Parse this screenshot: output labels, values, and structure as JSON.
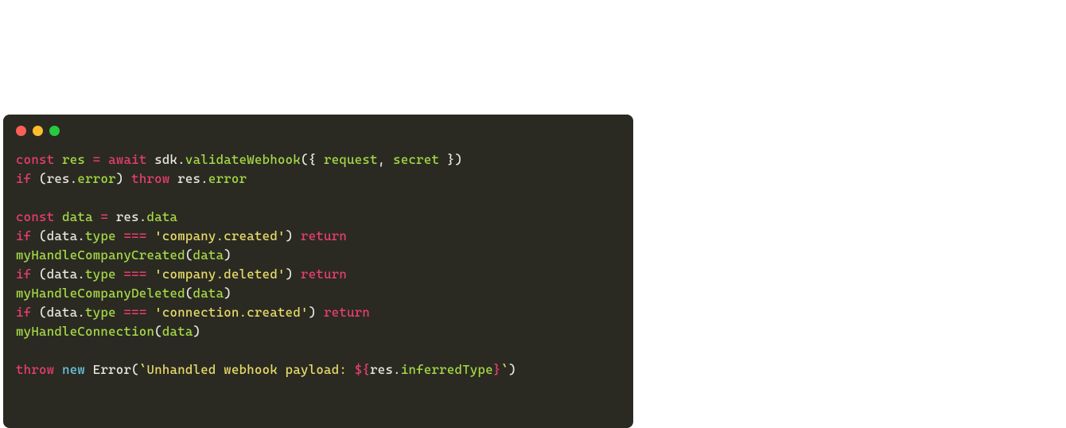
{
  "colors": {
    "bg": "#2a2a22",
    "keyword": "#e83e6b",
    "identifier": "#a6d945",
    "string": "#e7db6b",
    "plain": "#e8e6df",
    "new": "#6cc5e0",
    "close": "#ff5f56",
    "min": "#ffbd2e",
    "max": "#27c93f"
  },
  "code": {
    "lines": [
      {
        "tokens": [
          {
            "t": "const ",
            "c": "keyword"
          },
          {
            "t": "res",
            "c": "ident"
          },
          {
            "t": " ",
            "c": "plain"
          },
          {
            "t": "=",
            "c": "op"
          },
          {
            "t": " ",
            "c": "plain"
          },
          {
            "t": "await",
            "c": "keyword"
          },
          {
            "t": " sdk.",
            "c": "plain"
          },
          {
            "t": "validateWebhook",
            "c": "func"
          },
          {
            "t": "({ ",
            "c": "plain"
          },
          {
            "t": "request",
            "c": "ident"
          },
          {
            "t": ", ",
            "c": "plain"
          },
          {
            "t": "secret",
            "c": "ident"
          },
          {
            "t": " })",
            "c": "plain"
          }
        ]
      },
      {
        "tokens": [
          {
            "t": "if",
            "c": "keyword"
          },
          {
            "t": " (res.",
            "c": "plain"
          },
          {
            "t": "error",
            "c": "ident"
          },
          {
            "t": ") ",
            "c": "plain"
          },
          {
            "t": "throw",
            "c": "keyword"
          },
          {
            "t": " res.",
            "c": "plain"
          },
          {
            "t": "error",
            "c": "ident"
          }
        ]
      },
      {
        "tokens": []
      },
      {
        "tokens": [
          {
            "t": "const ",
            "c": "keyword"
          },
          {
            "t": "data",
            "c": "ident"
          },
          {
            "t": " ",
            "c": "plain"
          },
          {
            "t": "=",
            "c": "op"
          },
          {
            "t": " res.",
            "c": "plain"
          },
          {
            "t": "data",
            "c": "ident"
          }
        ]
      },
      {
        "tokens": [
          {
            "t": "if",
            "c": "keyword"
          },
          {
            "t": " (data.",
            "c": "plain"
          },
          {
            "t": "type",
            "c": "ident"
          },
          {
            "t": " ",
            "c": "plain"
          },
          {
            "t": "===",
            "c": "op"
          },
          {
            "t": " ",
            "c": "plain"
          },
          {
            "t": "'company.created'",
            "c": "string"
          },
          {
            "t": ") ",
            "c": "plain"
          },
          {
            "t": "return",
            "c": "keyword"
          },
          {
            "t": " ",
            "c": "plain"
          }
        ]
      },
      {
        "tokens": [
          {
            "t": "myHandleCompanyCreated",
            "c": "func"
          },
          {
            "t": "(",
            "c": "plain"
          },
          {
            "t": "data",
            "c": "ident"
          },
          {
            "t": ")",
            "c": "plain"
          }
        ]
      },
      {
        "tokens": [
          {
            "t": "if",
            "c": "keyword"
          },
          {
            "t": " (data.",
            "c": "plain"
          },
          {
            "t": "type",
            "c": "ident"
          },
          {
            "t": " ",
            "c": "plain"
          },
          {
            "t": "===",
            "c": "op"
          },
          {
            "t": " ",
            "c": "plain"
          },
          {
            "t": "'company.deleted'",
            "c": "string"
          },
          {
            "t": ") ",
            "c": "plain"
          },
          {
            "t": "return",
            "c": "keyword"
          },
          {
            "t": " ",
            "c": "plain"
          }
        ]
      },
      {
        "tokens": [
          {
            "t": "myHandleCompanyDeleted",
            "c": "func"
          },
          {
            "t": "(",
            "c": "plain"
          },
          {
            "t": "data",
            "c": "ident"
          },
          {
            "t": ")",
            "c": "plain"
          }
        ]
      },
      {
        "tokens": [
          {
            "t": "if",
            "c": "keyword"
          },
          {
            "t": " (data.",
            "c": "plain"
          },
          {
            "t": "type",
            "c": "ident"
          },
          {
            "t": " ",
            "c": "plain"
          },
          {
            "t": "===",
            "c": "op"
          },
          {
            "t": " ",
            "c": "plain"
          },
          {
            "t": "'connection.created'",
            "c": "string"
          },
          {
            "t": ") ",
            "c": "plain"
          },
          {
            "t": "return",
            "c": "keyword"
          },
          {
            "t": " ",
            "c": "plain"
          }
        ]
      },
      {
        "tokens": [
          {
            "t": "myHandleConnection",
            "c": "func"
          },
          {
            "t": "(",
            "c": "plain"
          },
          {
            "t": "data",
            "c": "ident"
          },
          {
            "t": ")",
            "c": "plain"
          }
        ]
      },
      {
        "tokens": []
      },
      {
        "tokens": [
          {
            "t": "throw",
            "c": "keyword"
          },
          {
            "t": " ",
            "c": "plain"
          },
          {
            "t": "new",
            "c": "new"
          },
          {
            "t": " Error",
            "c": "plain"
          },
          {
            "t": "(",
            "c": "plain"
          },
          {
            "t": "`Unhandled webhook payload: ",
            "c": "tmpl"
          },
          {
            "t": "${",
            "c": "op"
          },
          {
            "t": "res.",
            "c": "plain"
          },
          {
            "t": "inferredType",
            "c": "ident"
          },
          {
            "t": "}",
            "c": "op"
          },
          {
            "t": "`",
            "c": "tmpl"
          },
          {
            "t": ")",
            "c": "plain"
          }
        ]
      }
    ]
  }
}
